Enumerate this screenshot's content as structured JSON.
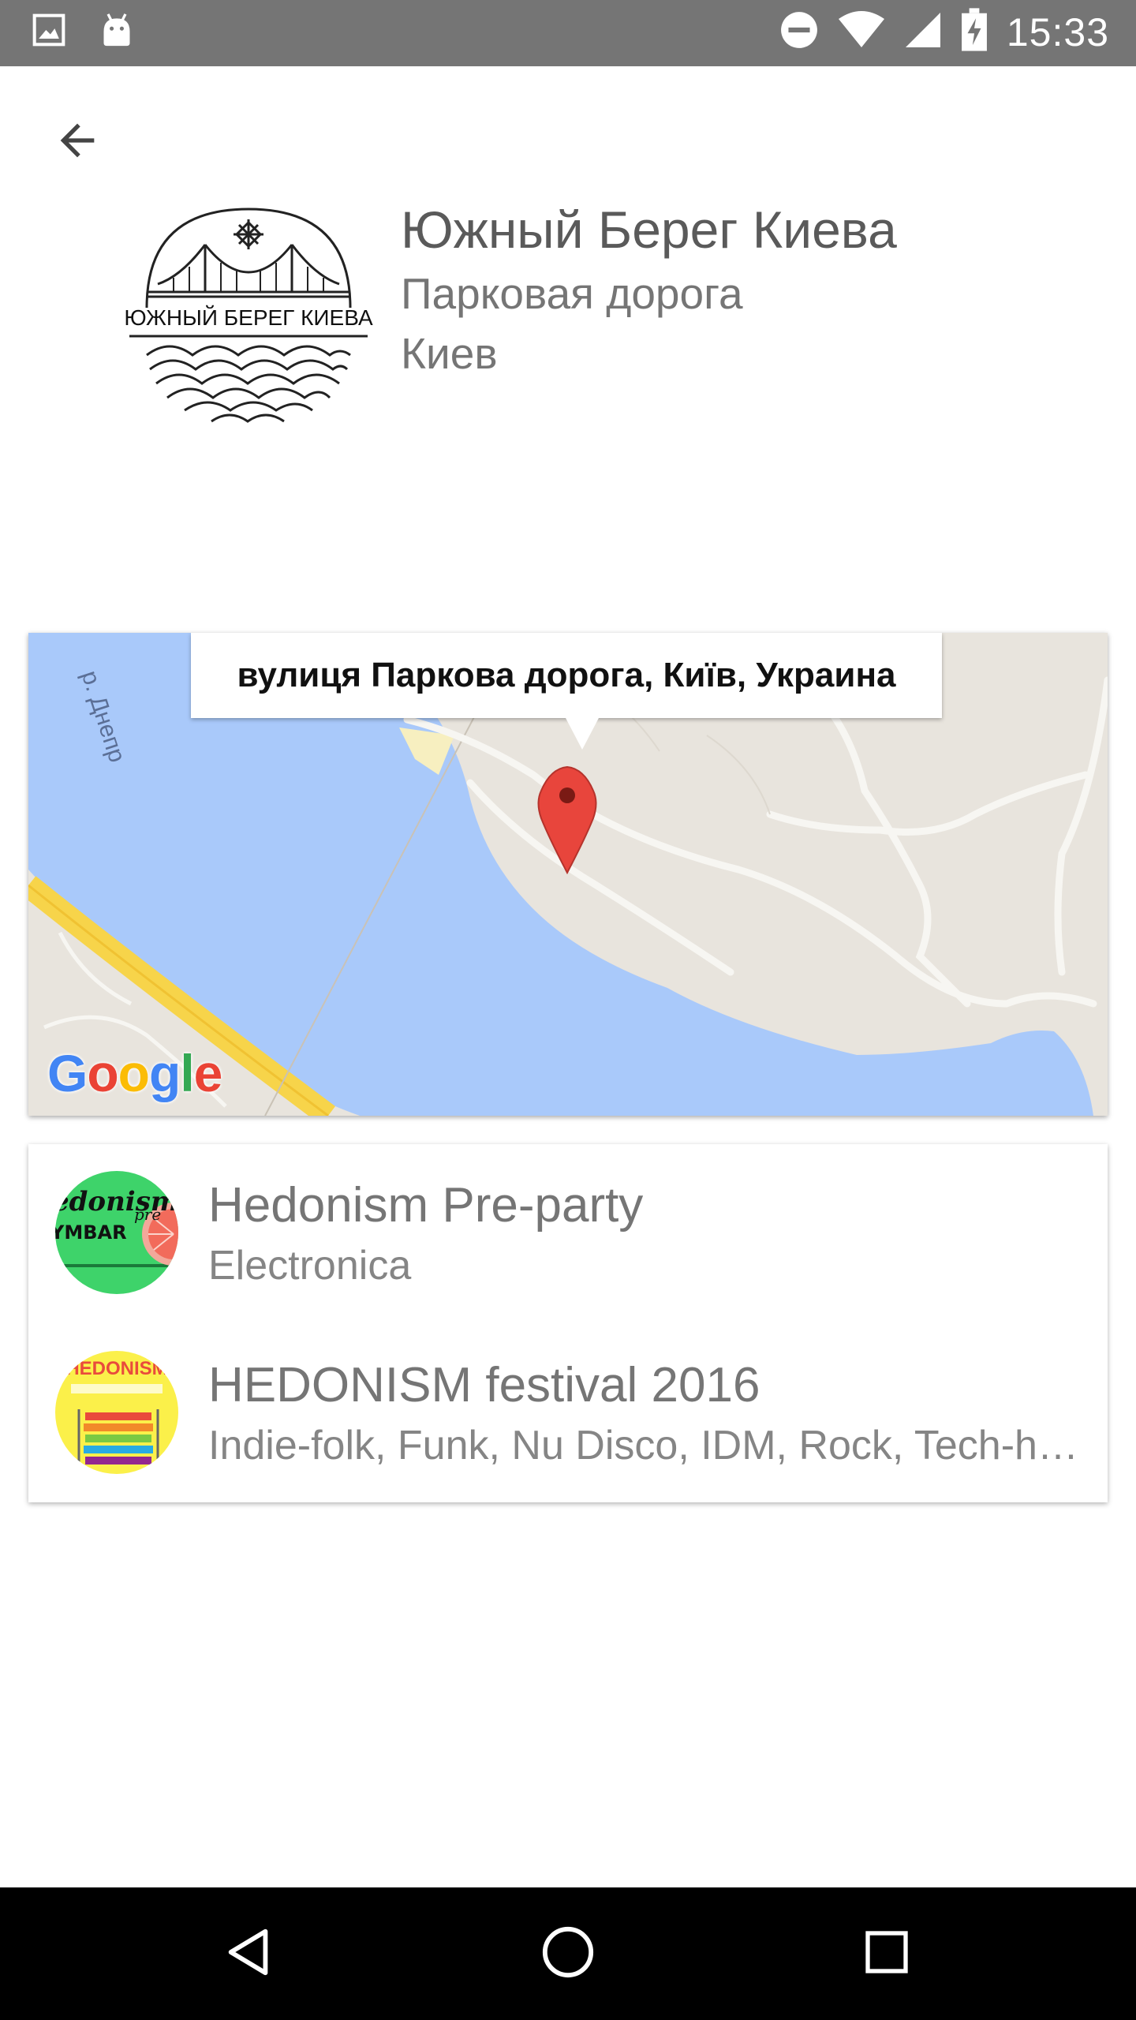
{
  "status_bar": {
    "time": "15:33",
    "icons": [
      "image-icon",
      "android-icon",
      "do-not-disturb-icon",
      "wifi-icon",
      "signal-icon",
      "battery-charging-icon"
    ]
  },
  "header": {
    "back_icon": "arrow-back-icon"
  },
  "venue": {
    "logo_text": "ЮЖНЫЙ БЕРЕГ КИЕВА",
    "name": "Южный Берег Киева",
    "street": "Парковая дорога",
    "city": "Киев"
  },
  "map": {
    "address_tooltip": "вулиця Паркова дорога, Київ, Украина",
    "river_label": "р. Днепр",
    "attribution": "Google",
    "colors": {
      "water": "#a9c9fa",
      "land": "#e8e4dd",
      "road_major": "#f7d44a",
      "marker": "#e8453c"
    }
  },
  "events": [
    {
      "title": "Hedonism Pre-party",
      "genres": "Electronica",
      "avatar_icon": "event-cover-green"
    },
    {
      "title": "HEDONISM festival 2016",
      "genres": "Indie-folk, Funk, Nu Disco, IDM, Rock, Tech-house, House",
      "avatar_icon": "event-cover-yellow"
    }
  ],
  "nav_bar": {
    "icons": [
      "nav-back-icon",
      "nav-home-icon",
      "nav-recents-icon"
    ]
  }
}
